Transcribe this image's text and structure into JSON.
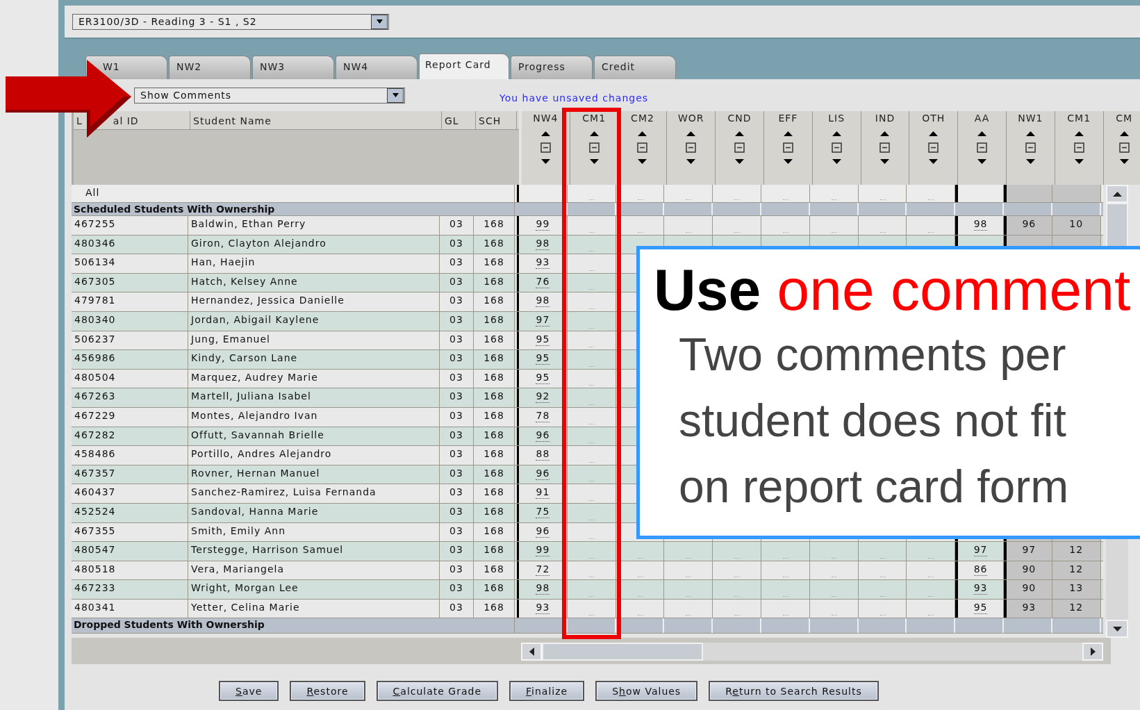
{
  "course_select": {
    "value": "ER3100/3D - Reading 3 - S1 , S2"
  },
  "tabs": [
    {
      "label": "W1",
      "selected": false
    },
    {
      "label": "NW2",
      "selected": false
    },
    {
      "label": "NW3",
      "selected": false
    },
    {
      "label": "NW4",
      "selected": false
    },
    {
      "label": "Report Card",
      "selected": true
    },
    {
      "label": "Progress",
      "selected": false
    },
    {
      "label": "Credit",
      "selected": false
    }
  ],
  "view_select": {
    "value": "Show Comments"
  },
  "notice": "You have unsaved changes",
  "table": {
    "fixed_columns": [
      {
        "label": "L",
        "label_after_arrow": "al ID"
      },
      {
        "label": "Student Name"
      },
      {
        "label": "GL"
      },
      {
        "label": "SCH"
      }
    ],
    "grade_columns": [
      {
        "label": "NW4",
        "kind": "score"
      },
      {
        "label": "CM1",
        "kind": "comment"
      },
      {
        "label": "CM2",
        "kind": "comment"
      },
      {
        "label": "WOR",
        "kind": "comment"
      },
      {
        "label": "CND",
        "kind": "comment"
      },
      {
        "label": "EFF",
        "kind": "comment"
      },
      {
        "label": "LIS",
        "kind": "comment"
      },
      {
        "label": "IND",
        "kind": "comment"
      },
      {
        "label": "OTH",
        "kind": "comment"
      },
      {
        "label": "AA",
        "kind": "average"
      },
      {
        "label": "NW1",
        "kind": "prior"
      },
      {
        "label": "CM1",
        "kind": "prior_comment"
      },
      {
        "label": "CM",
        "kind": "cut"
      }
    ],
    "all_row": "All",
    "section_title": "Scheduled Students With Ownership",
    "rows": [
      {
        "id": "467255",
        "name": "Baldwin, Ethan Perry",
        "gl": "03",
        "sch": "168",
        "nw4": "99",
        "aa": "98",
        "nw1": "96",
        "cm1": "10"
      },
      {
        "id": "480346",
        "name": "Giron, Clayton Alejandro",
        "gl": "03",
        "sch": "168",
        "nw4": "98"
      },
      {
        "id": "506134",
        "name": "Han, Haejin",
        "gl": "03",
        "sch": "168",
        "nw4": "93"
      },
      {
        "id": "467305",
        "name": "Hatch, Kelsey Anne",
        "gl": "03",
        "sch": "168",
        "nw4": "76"
      },
      {
        "id": "479781",
        "name": "Hernandez, Jessica Danielle",
        "gl": "03",
        "sch": "168",
        "nw4": "98"
      },
      {
        "id": "480340",
        "name": "Jordan, Abigail Kaylene",
        "gl": "03",
        "sch": "168",
        "nw4": "97"
      },
      {
        "id": "506237",
        "name": "Jung, Emanuel",
        "gl": "03",
        "sch": "168",
        "nw4": "95"
      },
      {
        "id": "456986",
        "name": "Kindy, Carson Lane",
        "gl": "03",
        "sch": "168",
        "nw4": "95"
      },
      {
        "id": "480504",
        "name": "Marquez, Audrey Marie",
        "gl": "03",
        "sch": "168",
        "nw4": "95"
      },
      {
        "id": "467263",
        "name": "Martell, Juliana Isabel",
        "gl": "03",
        "sch": "168",
        "nw4": "92"
      },
      {
        "id": "467229",
        "name": "Montes, Alejandro Ivan",
        "gl": "03",
        "sch": "168",
        "nw4": "78"
      },
      {
        "id": "467282",
        "name": "Offutt, Savannah Brielle",
        "gl": "03",
        "sch": "168",
        "nw4": "96"
      },
      {
        "id": "458486",
        "name": "Portillo, Andres Alejandro",
        "gl": "03",
        "sch": "168",
        "nw4": "88"
      },
      {
        "id": "467357",
        "name": "Rovner, Hernan Manuel",
        "gl": "03",
        "sch": "168",
        "nw4": "96"
      },
      {
        "id": "460437",
        "name": "Sanchez-Ramirez, Luisa Fernanda",
        "gl": "03",
        "sch": "168",
        "nw4": "91"
      },
      {
        "id": "452524",
        "name": "Sandoval, Hanna Marie",
        "gl": "03",
        "sch": "168",
        "nw4": "75"
      },
      {
        "id": "467355",
        "name": "Smith, Emily Ann",
        "gl": "03",
        "sch": "168",
        "nw4": "96"
      },
      {
        "id": "480547",
        "name": "Terstegge, Harrison Samuel",
        "gl": "03",
        "sch": "168",
        "nw4": "99",
        "aa": "97",
        "nw1": "97",
        "cm1": "12"
      },
      {
        "id": "480518",
        "name": "Vera, Mariangela",
        "gl": "03",
        "sch": "168",
        "nw4": "72",
        "aa": "86",
        "nw1": "90",
        "cm1": "12"
      },
      {
        "id": "467233",
        "name": "Wright, Morgan Lee",
        "gl": "03",
        "sch": "168",
        "nw4": "98",
        "aa": "93",
        "nw1": "90",
        "cm1": "13"
      },
      {
        "id": "480341",
        "name": "Yetter, Celina Marie",
        "gl": "03",
        "sch": "168",
        "nw4": "93",
        "aa": "95",
        "nw1": "93",
        "cm1": "12"
      }
    ],
    "dropped_title": "Dropped Students With Ownership"
  },
  "buttons": [
    {
      "key": "S",
      "after": "ave"
    },
    {
      "key": "R",
      "after": "estore"
    },
    {
      "key": "C",
      "after": "alculate Grade"
    },
    {
      "key": "F",
      "after": "inalize"
    },
    {
      "before": "S",
      "key": "h",
      "after": "ow Values"
    },
    {
      "before": "R",
      "key": "e",
      "after": "turn to Search Results"
    }
  ],
  "callout": {
    "lead": "Use",
    "highlight": "one comment",
    "lines": [
      "Two comments per",
      "student does not fit",
      "on report card form"
    ]
  }
}
